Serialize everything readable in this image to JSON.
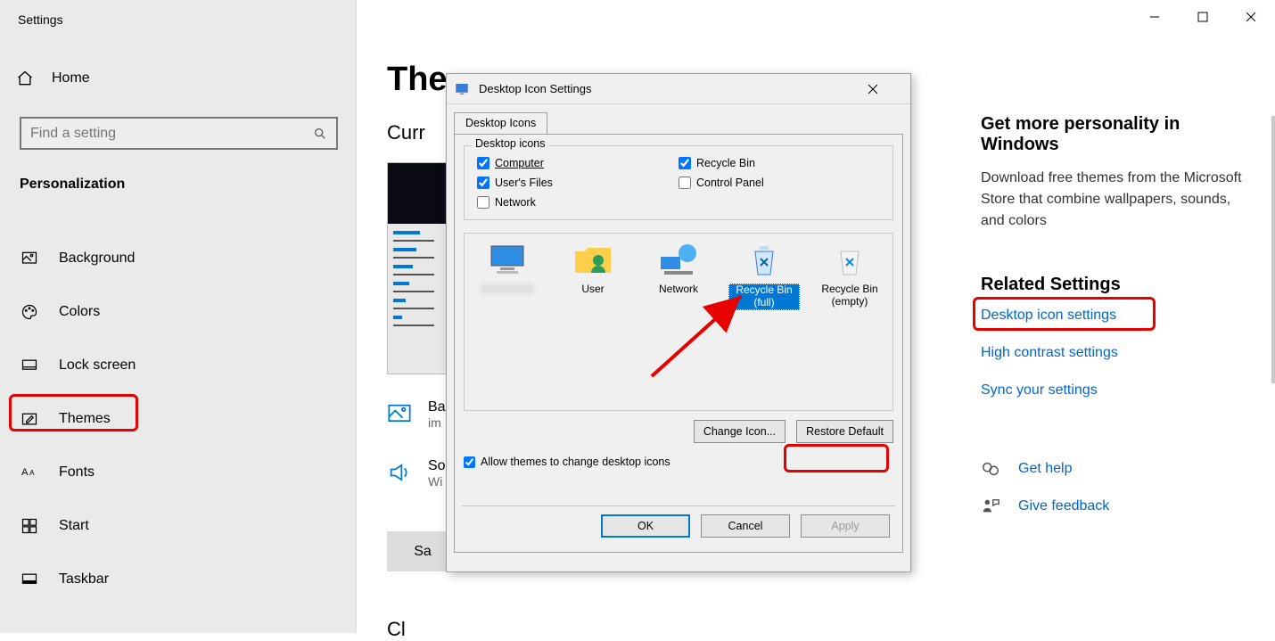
{
  "window_title": "Settings",
  "home_label": "Home",
  "search_placeholder": "Find a setting",
  "category": "Personalization",
  "nav": {
    "background": "Background",
    "colors": "Colors",
    "lockscreen": "Lock screen",
    "themes": "Themes",
    "fonts": "Fonts",
    "start": "Start",
    "taskbar": "Taskbar"
  },
  "page": {
    "title": "The",
    "current": "Curr",
    "row_bg_t1": "Ba",
    "row_bg_t2": "im",
    "row_so_t1": "So",
    "row_so_t2": "Wi",
    "save": "Sa",
    "change_peek": "Cl"
  },
  "right": {
    "personality_title": "Get more personality in Windows",
    "personality_body": "Download free themes from the Microsoft Store that combine wallpapers, sounds, and colors",
    "related_title": "Related Settings",
    "link_desktop_icon": "Desktop icon settings",
    "link_high_contrast": "High contrast settings",
    "link_sync": "Sync your settings",
    "get_help": "Get help",
    "give_feedback": "Give feedback"
  },
  "dialog": {
    "title": "Desktop Icon Settings",
    "tab": "Desktop Icons",
    "group_legend": "Desktop icons",
    "cb_computer": "Computer",
    "cb_users_files": "User's Files",
    "cb_network": "Network",
    "cb_recycle": "Recycle Bin",
    "cb_control_panel": "Control Panel",
    "icons": {
      "thispc": "",
      "user": "User",
      "network": "Network",
      "rb_full": "Recycle Bin (full)",
      "rb_empty": "Recycle Bin (empty)"
    },
    "change_icon": "Change Icon...",
    "restore_default": "Restore Default",
    "allow": "Allow themes to change desktop icons",
    "ok": "OK",
    "cancel": "Cancel",
    "apply": "Apply"
  }
}
